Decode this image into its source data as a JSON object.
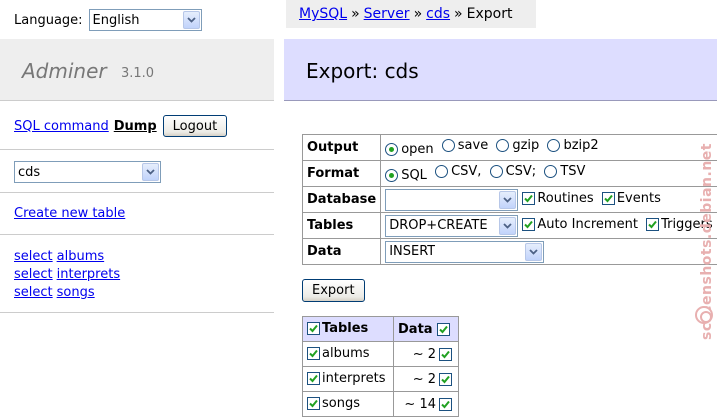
{
  "language": {
    "label": "Language:",
    "selected": "English"
  },
  "brand": {
    "name": "Adminer",
    "version": "3.1.0"
  },
  "commands": {
    "sql_command": "SQL command",
    "dump": "Dump",
    "logout": "Logout"
  },
  "database_select": {
    "selected": "cds"
  },
  "create_table": "Create new table",
  "table_links": {
    "select_label": "select",
    "tables": [
      "albums",
      "interprets",
      "songs"
    ]
  },
  "breadcrumb": {
    "mysql": "MySQL",
    "server": "Server",
    "db": "cds",
    "current": "Export",
    "separator": "»"
  },
  "page_title": "Export: cds",
  "form": {
    "output": {
      "label": "Output",
      "options": [
        "open",
        "save",
        "gzip",
        "bzip2"
      ],
      "selected": "open"
    },
    "format": {
      "label": "Format",
      "options": [
        "SQL",
        "CSV,",
        "CSV;",
        "TSV"
      ],
      "selected": "SQL"
    },
    "database": {
      "label": "Database",
      "selected": "",
      "routines": "Routines",
      "events": "Events"
    },
    "tables": {
      "label": "Tables",
      "selected": "DROP+CREATE",
      "auto_increment": "Auto Increment",
      "triggers": "Triggers"
    },
    "data": {
      "label": "Data",
      "selected": "INSERT"
    }
  },
  "export_button": "Export",
  "table_grid": {
    "header_tables": "Tables",
    "header_data": "Data",
    "rows": [
      {
        "name": "albums",
        "count": "~ 2"
      },
      {
        "name": "interprets",
        "count": "~ 2"
      },
      {
        "name": "songs",
        "count": "~ 14"
      }
    ]
  },
  "watermark": "screenshots.debian.net",
  "colors": {
    "link": "#0000ee",
    "header_bg": "#ddddff",
    "panel_bg": "#eeeeee"
  }
}
